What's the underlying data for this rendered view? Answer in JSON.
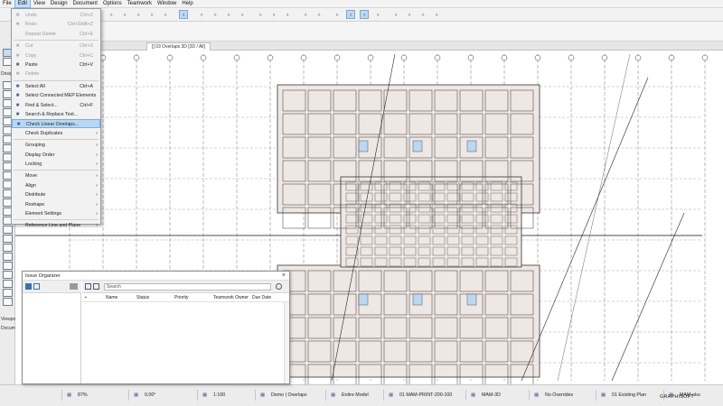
{
  "menubar": {
    "items": [
      "File",
      "Edit",
      "View",
      "Design",
      "Document",
      "Options",
      "Teamwork",
      "Window",
      "Help"
    ],
    "active": "Edit"
  },
  "toolbox": {
    "labels": [
      "Desig",
      "Viewpoi",
      "Docume"
    ]
  },
  "tab": {
    "label": "[] 03 Overlaps 3D [3D / All]"
  },
  "edit_menu": {
    "items": [
      {
        "label": "Undo",
        "shortcut": "Ctrl+Z",
        "disabled": true,
        "icon": "undo-icon"
      },
      {
        "label": "Redo",
        "shortcut": "Ctrl+Shift+Z",
        "disabled": true,
        "icon": "redo-icon"
      },
      {
        "label": "Repeat Delete",
        "shortcut": "Ctrl+E",
        "disabled": true,
        "icon": ""
      },
      {
        "sep": true
      },
      {
        "label": "Cut",
        "shortcut": "Ctrl+X",
        "disabled": true,
        "icon": "cut-icon"
      },
      {
        "label": "Copy",
        "shortcut": "Ctrl+C",
        "disabled": true,
        "icon": "copy-icon"
      },
      {
        "label": "Paste",
        "shortcut": "Ctrl+V",
        "disabled": false,
        "icon": "paste-icon"
      },
      {
        "label": "Delete",
        "shortcut": "",
        "disabled": true,
        "icon": "delete-icon"
      },
      {
        "sep": true
      },
      {
        "label": "Select All",
        "shortcut": "Ctrl+A",
        "disabled": false,
        "icon": "select-all-icon"
      },
      {
        "label": "Select Connected MEP Elements",
        "shortcut": "",
        "disabled": false,
        "icon": "mep-icon"
      },
      {
        "label": "Find & Select...",
        "shortcut": "Ctrl+F",
        "disabled": false,
        "icon": "find-icon"
      },
      {
        "label": "Search & Replace Text...",
        "shortcut": "",
        "disabled": false,
        "icon": "search-replace-icon"
      },
      {
        "label": "Check Linear Overlaps...",
        "shortcut": "",
        "disabled": false,
        "icon": "overlap-icon",
        "highlighted": true
      },
      {
        "label": "Check Duplicates",
        "shortcut": "",
        "disabled": false,
        "icon": "",
        "submenu": true
      },
      {
        "sep": true
      },
      {
        "label": "Grouping",
        "shortcut": "",
        "disabled": false,
        "icon": "",
        "submenu": true
      },
      {
        "label": "Display Order",
        "shortcut": "",
        "disabled": false,
        "icon": "",
        "submenu": true
      },
      {
        "label": "Locking",
        "shortcut": "",
        "disabled": false,
        "icon": "",
        "submenu": true
      },
      {
        "sep": true
      },
      {
        "label": "Move",
        "shortcut": "",
        "disabled": false,
        "icon": "",
        "submenu": true
      },
      {
        "label": "Align",
        "shortcut": "",
        "disabled": false,
        "icon": "",
        "submenu": true
      },
      {
        "label": "Distribute",
        "shortcut": "",
        "disabled": false,
        "icon": "",
        "submenu": true
      },
      {
        "label": "Reshape",
        "shortcut": "",
        "disabled": false,
        "icon": "",
        "submenu": true
      },
      {
        "label": "Element Settings",
        "shortcut": "",
        "disabled": false,
        "icon": "",
        "submenu": true
      },
      {
        "sep": true
      },
      {
        "label": "Reference Line and Plane",
        "shortcut": "",
        "disabled": false,
        "icon": "",
        "submenu": true
      }
    ]
  },
  "issue_organizer": {
    "title": "Issue Organizer",
    "search_placeholder": "Search",
    "columns": [
      "Name",
      "Status",
      "Priority",
      "Teamwork Owner",
      "Due Date"
    ]
  },
  "statusbar": {
    "items": [
      {
        "text": "87%",
        "icon": "zoom-icon"
      },
      {
        "text": "0,00°",
        "icon": "angle-icon"
      },
      {
        "text": "1:100",
        "icon": "scale-icon"
      },
      {
        "text": "Demo | Overlaps",
        "icon": "layer-icon"
      },
      {
        "text": "Entire Model",
        "icon": "model-icon"
      },
      {
        "text": "01 MAM-PRINT-200-100",
        "icon": "pen-icon"
      },
      {
        "text": "MAM-3D",
        "icon": "view-icon"
      },
      {
        "text": "No Overrides",
        "icon": "override-icon"
      },
      {
        "text": "01 Existing Plan",
        "icon": "renovation-icon"
      },
      {
        "text": "MAM-oku",
        "icon": "profile-icon"
      }
    ],
    "logo": "GRAPHISOFT"
  }
}
